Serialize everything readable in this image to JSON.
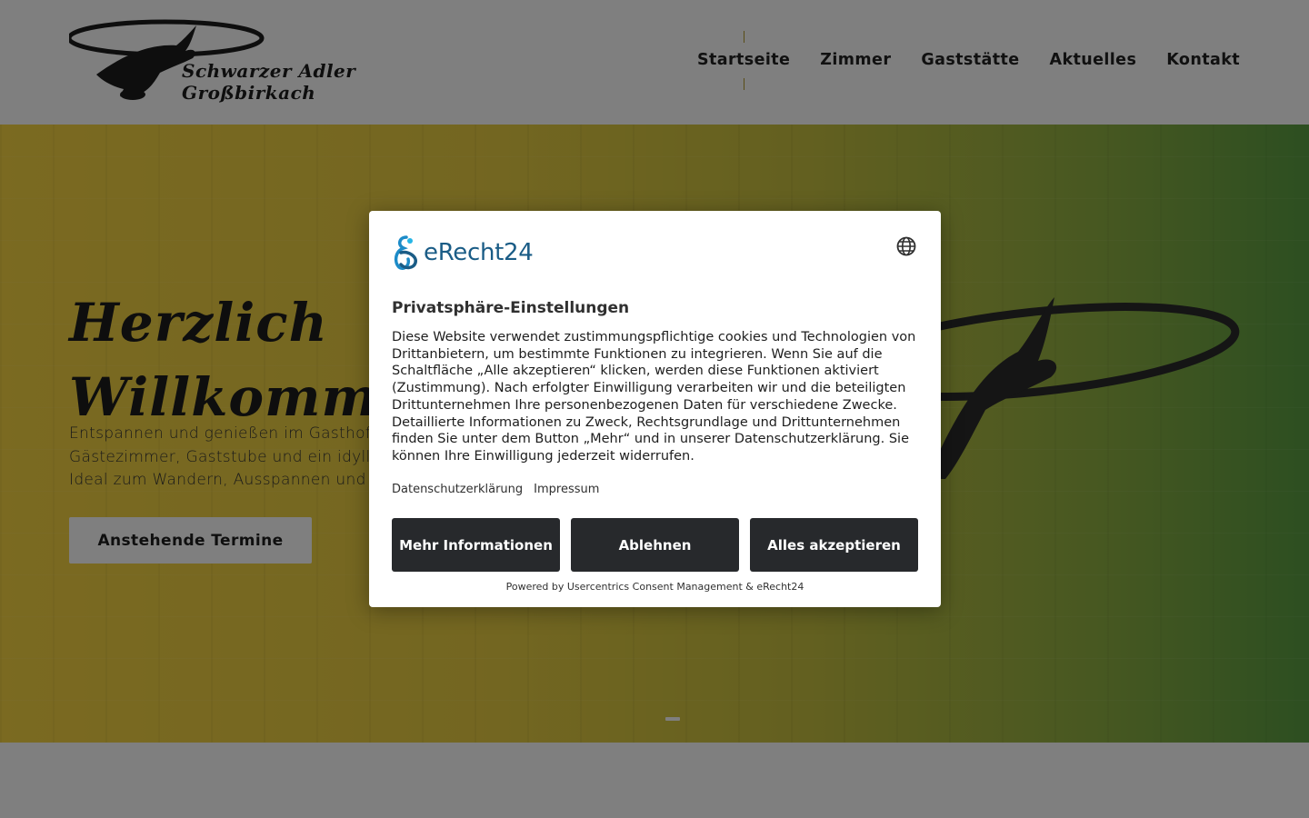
{
  "site": {
    "logo": {
      "line1": "Schwarzer Adler",
      "line2": "Großbirkach",
      "icon": "eagle-icon"
    },
    "nav": {
      "items": [
        {
          "label": "Startseite",
          "active": true
        },
        {
          "label": "Zimmer",
          "active": false
        },
        {
          "label": "Gaststätte",
          "active": false
        },
        {
          "label": "Aktuelles",
          "active": false
        },
        {
          "label": "Kontakt",
          "active": false
        }
      ]
    }
  },
  "hero": {
    "title": "Herzlich Willkommen",
    "text": "Entspannen und genießen im Gasthof: \nGästezimmer, Gaststube und ein idyllis\nIdeal zum Wandern, Ausspannen und E",
    "button_label": "Anstehende Termine",
    "gradient_colors": [
      "#f6d443",
      "#5a9e42"
    ]
  },
  "consent": {
    "brand": "eRecht24",
    "language_icon": "globe-icon",
    "title": "Privatsphäre-Einstellungen",
    "text": "Diese Website verwendet zustimmungspflichtige cookies und Technologien von Drittanbietern, um bestimmte Funktionen zu integrieren. Wenn Sie auf die Schaltfläche „Alle akzeptieren“ klicken, werden diese Funktionen aktiviert (Zustimmung). Nach erfolgter Einwilligung verarbeiten wir und die beteiligten Drittunternehmen Ihre personenbezogenen Daten für verschiedene Zwecke. Detaillierte Informationen zu Zweck, Rechtsgrundlage und Drittunternehmen finden Sie unter dem Button „Mehr“ und in unserer Datenschutzerklärung. Sie können Ihre Einwilligung jederzeit widerrufen.",
    "links": {
      "privacy": "Datenschutzerklärung",
      "imprint": "Impressum"
    },
    "buttons": {
      "more": "Mehr Informationen",
      "deny": "Ablehnen",
      "accept": "Alles akzeptieren"
    },
    "powered_by": "Powered by Usercentrics Consent Management & eRecht24",
    "button_color": "#27292c",
    "brand_color": "#1a5c86"
  }
}
